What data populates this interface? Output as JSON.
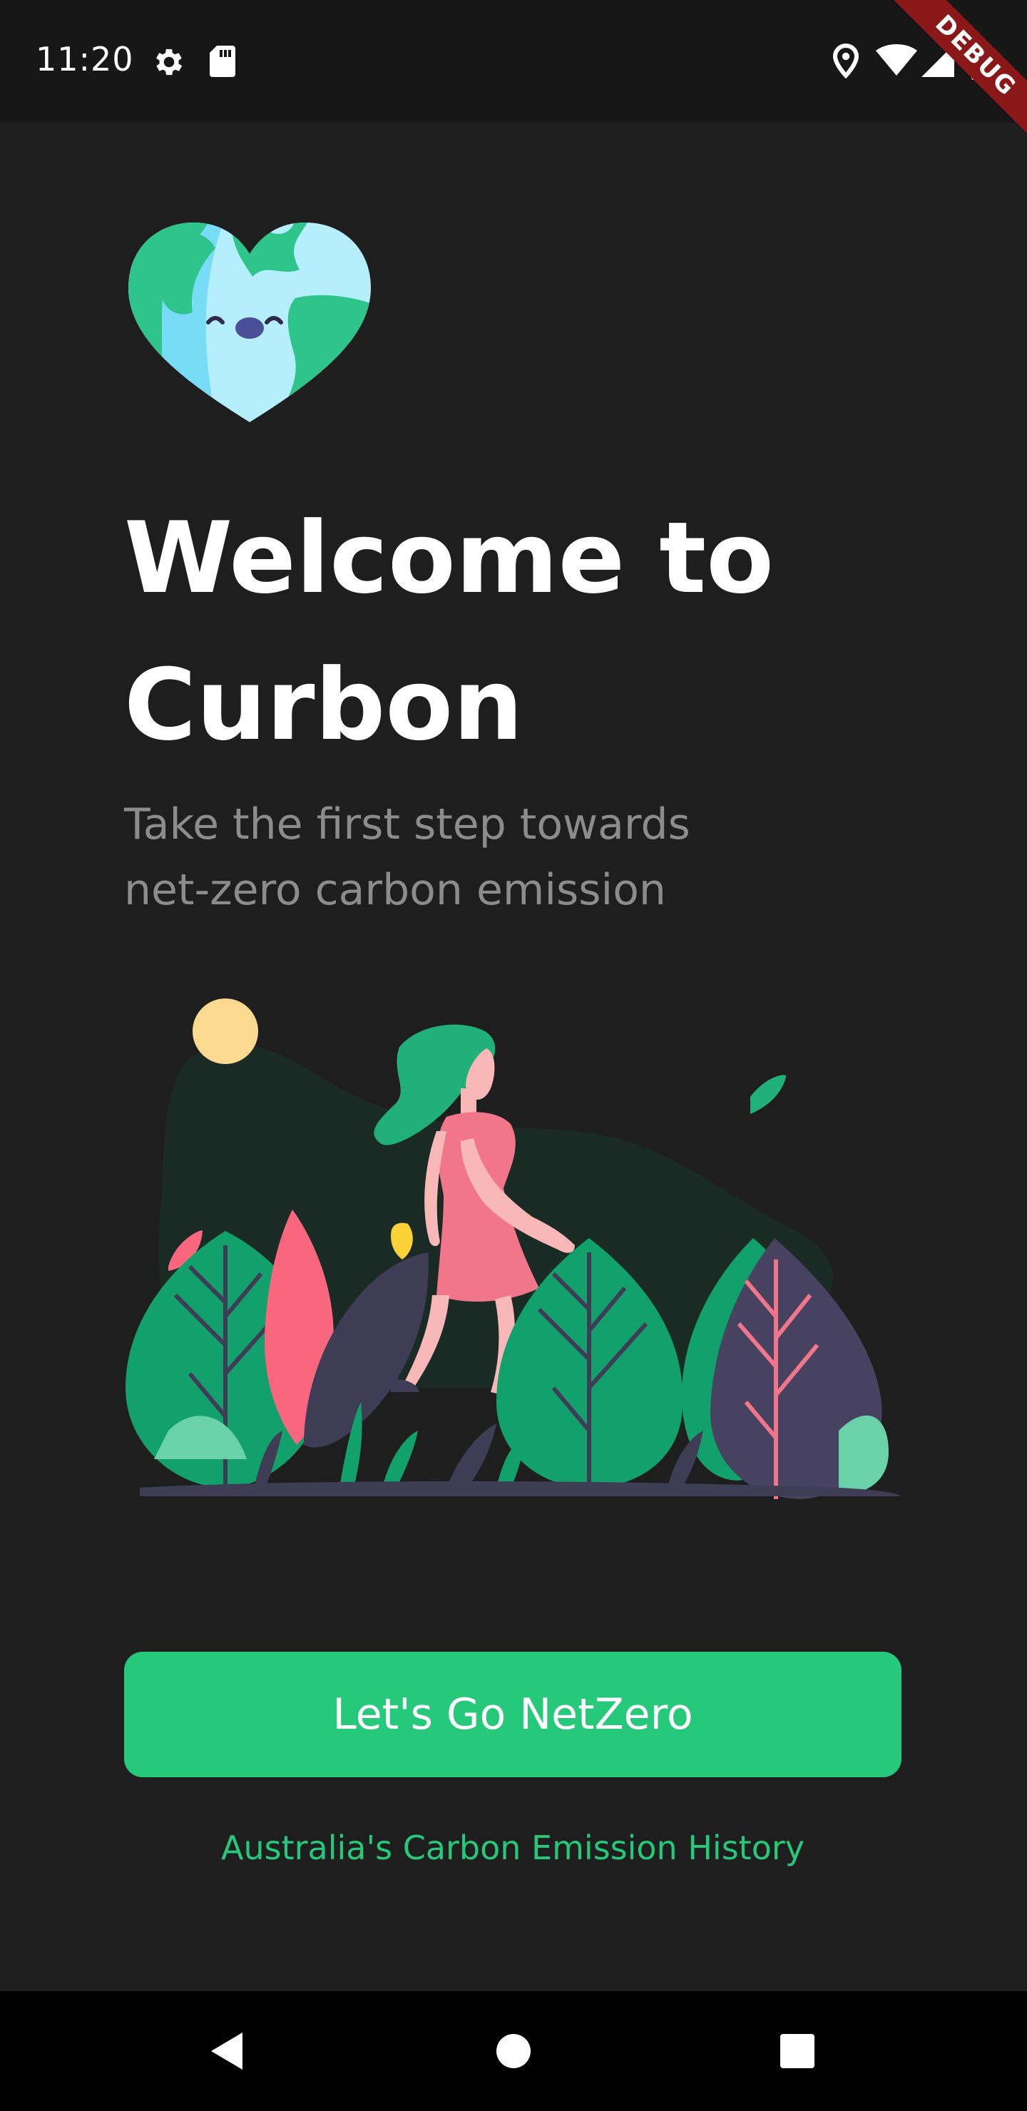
{
  "status_bar": {
    "time": "11:20",
    "debug_label": "DEBUG",
    "left_icons": [
      "gear-icon",
      "sd-card-icon"
    ],
    "right_icons": [
      "location-icon",
      "wifi-icon",
      "signal-icon",
      "battery-icon"
    ]
  },
  "welcome": {
    "logo_icon": "earth-heart-icon",
    "title_line1": "Welcome to",
    "title_line2": "Curbon",
    "subtitle": "Take the first step towards net-zero carbon emission"
  },
  "illustration": {
    "icon": "woman-walking-in-nature-illustration"
  },
  "actions": {
    "primary_button": "Let's Go NetZero",
    "secondary_link": "Australia's Carbon Emission History"
  },
  "nav_bar": {
    "items": [
      "back-icon",
      "home-icon",
      "recents-icon"
    ]
  },
  "colors": {
    "background": "#1e1e1f",
    "accent": "#26c97a",
    "title": "#ffffff",
    "subtitle": "#8c8c8c"
  }
}
